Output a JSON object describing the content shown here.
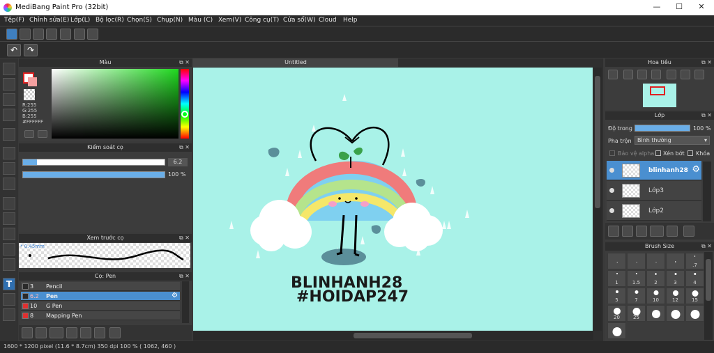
{
  "window": {
    "title": "MediBang Paint Pro (32bit)",
    "minimize": "—",
    "maximize": "☐",
    "close": "✕"
  },
  "menu": [
    "Tệp(F)",
    "Chỉnh sửa(E)",
    "Lớp(L)",
    "Bộ lọc(R)",
    "Chọn(S)",
    "Chụp(N)",
    "Màu (C)",
    "Xem(V)",
    "Công cụ(T)",
    "Cửa sổ(W)",
    "Cloud",
    "Help"
  ],
  "color_panel": {
    "title": "Màu",
    "r": "R:255",
    "g": "G:255",
    "b": "B:255",
    "hex": "#FFFFFF"
  },
  "brush_control": {
    "title": "Kiểm soát cọ",
    "size_value": "6.2",
    "size_fill": 0.1,
    "opacity_value": "100 %",
    "opacity_fill": 1.0
  },
  "brush_preview": {
    "title": "Xem trước cọ",
    "size_label": "* 0.45mm"
  },
  "brush_list": {
    "title": "Cọ: Pen",
    "items": [
      {
        "size": "3",
        "name": "Pencil",
        "color": "#2a2a2a",
        "selected": false
      },
      {
        "size": "6.2",
        "name": "Pen",
        "color": "#2a2a2a",
        "selected": true
      },
      {
        "size": "10",
        "name": "G Pen",
        "color": "#e03030",
        "selected": false
      },
      {
        "size": "8",
        "name": "Mapping Pen",
        "color": "#e03030",
        "selected": false
      }
    ]
  },
  "canvas": {
    "tab": "Untitled",
    "bg_color": "#a9f2e8",
    "text_line1": "BLINHANH28",
    "text_line2": "#HOIDAP247"
  },
  "navigator": {
    "title": "Hoa tiêu"
  },
  "layer_panel": {
    "title": "Lớp",
    "opacity_label": "Độ trong",
    "opacity_value": "100 %",
    "blend_label": "Pha trộn",
    "blend_value": "Bình thường",
    "protect_alpha": "Bảo vệ alpha",
    "clip": "Xén bớt",
    "lock": "Khóa",
    "layers": [
      {
        "name": "blinhanh28",
        "selected": true
      },
      {
        "name": "Lớp3",
        "selected": false
      },
      {
        "name": "Lớp2",
        "selected": false
      }
    ]
  },
  "brush_size": {
    "title": "Brush Size",
    "cells": [
      "",
      "",
      "",
      "",
      ".7",
      "1",
      "1.5",
      "2",
      "3",
      "4",
      "5",
      "7",
      "10",
      "12",
      "15",
      "20",
      "25",
      "",
      "",
      "",
      ""
    ]
  },
  "status": {
    "text": "1600 * 1200 pixel   (11.6 * 8.7cm)   350 dpi   100 %   ( 1062, 460 )"
  }
}
